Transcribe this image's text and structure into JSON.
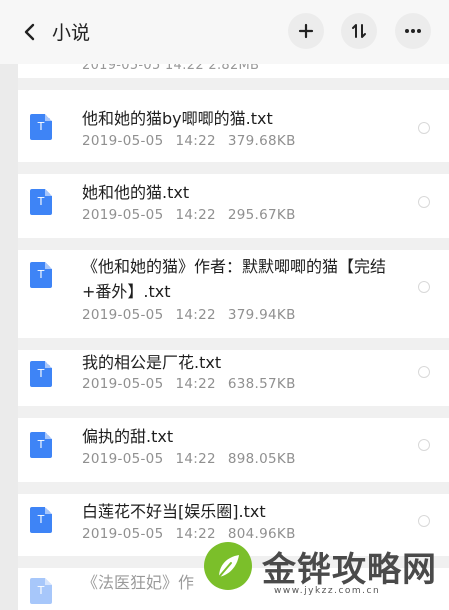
{
  "header": {
    "title": "小说",
    "back_icon": "chevron-left-icon",
    "add_icon": "plus-icon",
    "sort_icon": "sort-icon",
    "more_icon": "more-dots-icon"
  },
  "list": {
    "peek_meta": "2019-05-05  14:22  2.82MB",
    "items": [
      {
        "name": "他和她的猫by唧唧的猫.txt",
        "date": "2019-05-05",
        "time": "14:22",
        "size": "379.68KB",
        "icon_letter": "T"
      },
      {
        "name": "她和他的猫.txt",
        "date": "2019-05-05",
        "time": "14:22",
        "size": "295.67KB",
        "icon_letter": "T"
      },
      {
        "name": "《他和她的猫》作者：默默唧唧的猫【完结+番外】.txt",
        "date": "2019-05-05",
        "time": "14:22",
        "size": "379.94KB",
        "icon_letter": "T"
      },
      {
        "name": "我的相公是厂花.txt",
        "date": "2019-05-05",
        "time": "14:22",
        "size": "638.57KB",
        "icon_letter": "T"
      },
      {
        "name": "偏执的甜.txt",
        "date": "2019-05-05",
        "time": "14:22",
        "size": "898.05KB",
        "icon_letter": "T"
      },
      {
        "name": "白莲花不好当[娱乐圈].txt",
        "date": "2019-05-05",
        "time": "14:22",
        "size": "804.96KB",
        "icon_letter": "T"
      },
      {
        "name": "《法医狂妃》作",
        "date": "",
        "time": "",
        "size": "",
        "icon_letter": "T"
      }
    ]
  },
  "watermark": {
    "text": "金铧攻略网",
    "url": "www.jykzz.com.cn",
    "logo_color": "#7bbf2a"
  },
  "colors": {
    "accent_file": "#3e84f6",
    "background": "#ebebeb",
    "text_primary": "#1e1e1e",
    "text_secondary": "#909090"
  }
}
